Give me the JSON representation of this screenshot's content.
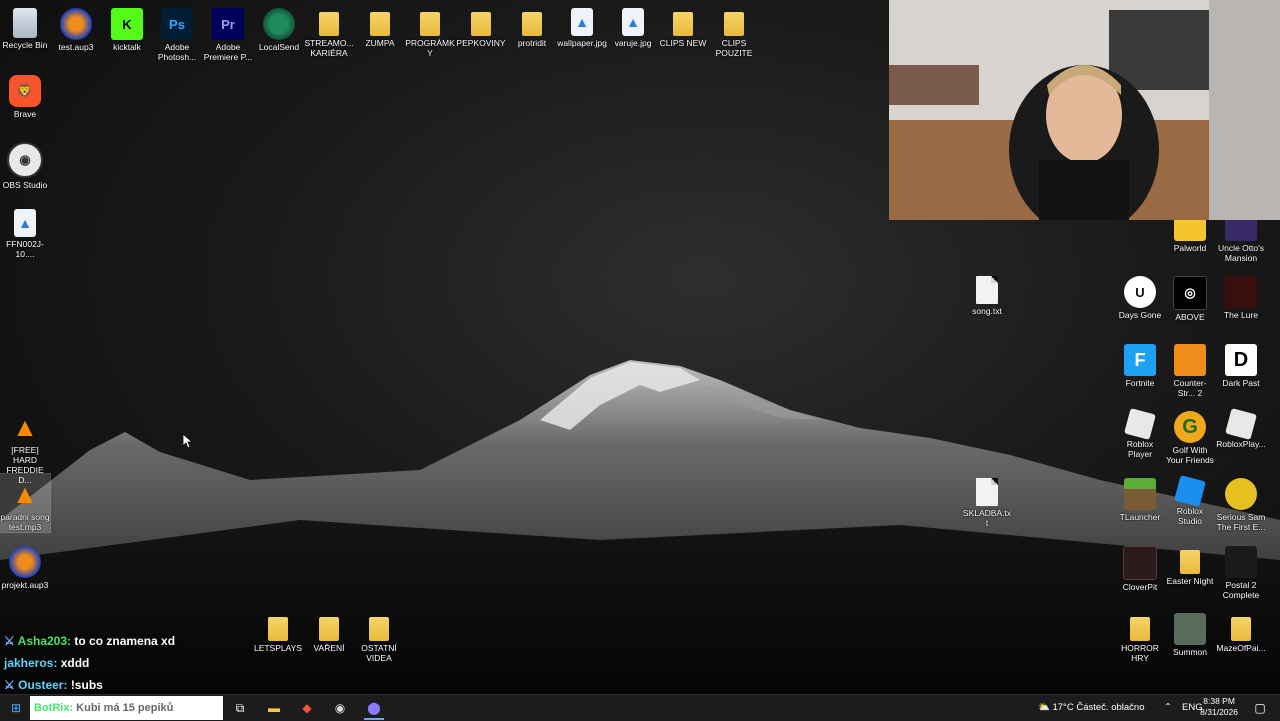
{
  "desktop": {
    "top_row": [
      {
        "label": "Recycle Bin",
        "icon": "recycle-bin-icon"
      },
      {
        "label": "test.aup3",
        "icon": "audacity-icon"
      },
      {
        "label": "kicktalk",
        "icon": "kick-icon"
      },
      {
        "label": "Adobe Photosh...",
        "icon": "photoshop-icon",
        "glyph": "Ps"
      },
      {
        "label": "Adobe Premiere P...",
        "icon": "premiere-icon",
        "glyph": "Pr"
      },
      {
        "label": "LocalSend",
        "icon": "localsend-icon"
      },
      {
        "label": "STREAMO... KARIÉRA",
        "icon": "folder-icon"
      },
      {
        "label": "ZUMPA",
        "icon": "folder-icon"
      },
      {
        "label": "PROGRÁMKY",
        "icon": "folder-icon"
      },
      {
        "label": "PEPKOVINY",
        "icon": "folder-icon"
      },
      {
        "label": "protridit",
        "icon": "folder-icon"
      },
      {
        "label": "wallpaper.jpg",
        "icon": "image-file-icon"
      },
      {
        "label": "varuje.jpg",
        "icon": "image-file-icon"
      },
      {
        "label": "CLIPS NEW",
        "icon": "folder-icon"
      },
      {
        "label": "CLIPS POUZITE",
        "icon": "folder-icon"
      }
    ],
    "left_column": [
      {
        "label": "Brave",
        "icon": "brave-icon"
      },
      {
        "label": "OBS Studio",
        "icon": "obs-icon"
      },
      {
        "label": "FFN002J-10....",
        "icon": "image-file-icon"
      },
      {
        "label": "[FREE] HARD FREDDIE D...",
        "icon": "vlc-icon"
      },
      {
        "label": "paradni song test.mp3",
        "icon": "vlc-icon"
      },
      {
        "label": "projekt.aup3",
        "icon": "audacity-icon"
      }
    ],
    "bottom_folders": [
      {
        "label": "LETSPLAYS",
        "icon": "folder-icon"
      },
      {
        "label": "VAŘENÍ",
        "icon": "folder-icon"
      },
      {
        "label": "OSTATNÍ VIDEA",
        "icon": "folder-icon"
      }
    ],
    "middle_files": [
      {
        "label": "song.txt",
        "icon": "text-file-icon"
      },
      {
        "label": "SKLADBA.txt",
        "icon": "text-file-icon"
      }
    ],
    "right_grid": [
      {
        "label": "Palworld",
        "icon": "palworld-icon"
      },
      {
        "label": "Uncle Otto's Mansion",
        "icon": "game-icon"
      },
      {
        "label": "Days Gone",
        "icon": "unreal-icon"
      },
      {
        "label": "ABOVE",
        "icon": "above-icon"
      },
      {
        "label": "The Lure",
        "icon": "game-icon"
      },
      {
        "label": "Fortnite",
        "icon": "fortnite-icon",
        "glyph": "F"
      },
      {
        "label": "Counter-Str... 2",
        "icon": "cs2-icon"
      },
      {
        "label": "Dark Past",
        "icon": "game-icon",
        "glyph": "D"
      },
      {
        "label": "Roblox Player",
        "icon": "roblox-icon"
      },
      {
        "label": "Golf With Your Friends",
        "icon": "golf-icon",
        "glyph": "G"
      },
      {
        "label": "RobloxPlay...",
        "icon": "roblox-icon"
      },
      {
        "label": "TLauncher",
        "icon": "minecraft-icon"
      },
      {
        "label": "Roblox Studio",
        "icon": "roblox-studio-icon"
      },
      {
        "label": "Serious Sam The First E...",
        "icon": "serious-sam-icon"
      },
      {
        "label": "CloverPit",
        "icon": "game-icon"
      },
      {
        "label": "Easter Night",
        "icon": "folder-icon"
      },
      {
        "label": "Postal 2 Complete",
        "icon": "game-icon"
      },
      {
        "label": "HORROR HRY",
        "icon": "folder-icon"
      },
      {
        "label": "Summon",
        "icon": "game-icon"
      },
      {
        "label": "MazeOfPai...",
        "icon": "folder-icon"
      }
    ]
  },
  "chat": [
    {
      "user": "Asha203:",
      "text": "to co znamena xd",
      "badges": "sword-icon subscriber-icon"
    },
    {
      "user": "jakheros:",
      "text": "xddd",
      "badges": ""
    },
    {
      "user": "Ousteer:",
      "text": "!subs",
      "badges": "sword-icon"
    },
    {
      "user": "BotRix:",
      "text": "Kubi má 15 pepiků",
      "badges": "bot-icon"
    }
  ],
  "taskbar": {
    "search_placeholder": "",
    "pinned": [
      "task-view-icon",
      "file-explorer-icon",
      "brave-icon",
      "obs-icon",
      "qbittorrent-icon"
    ],
    "weather_temp": "17°C",
    "weather_text": "Částeč. oblačno",
    "language": "ENG",
    "time": "8:38 PM",
    "date": "8/31/2026"
  }
}
